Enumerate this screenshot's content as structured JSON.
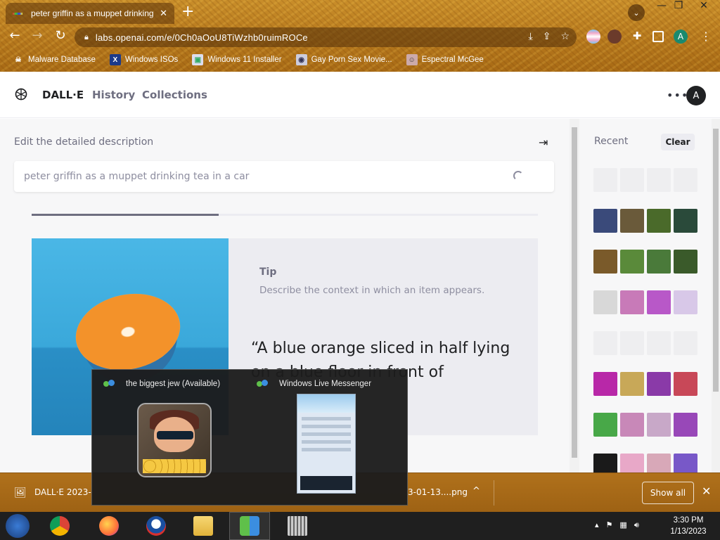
{
  "browser": {
    "tab_title": "peter griffin as a muppet drinking",
    "tab_close": "✕",
    "new_tab": "+",
    "url": "labs.openai.com/e/0Ch0aOoU8TiWzhb0ruimROCe",
    "profile_initial": "A",
    "bookmarks": [
      {
        "label": "Malware Database",
        "icon": "skull-icon"
      },
      {
        "label": "Windows ISOs",
        "icon": "x-icon"
      },
      {
        "label": "Windows 11 Installer",
        "icon": "windows-image-icon"
      },
      {
        "label": "Gay Porn Sex Movie...",
        "icon": "globe-icon"
      },
      {
        "label": "Espectral McGee",
        "icon": "face-icon"
      }
    ]
  },
  "app": {
    "brand": "DALL·E",
    "nav": [
      "History",
      "Collections"
    ],
    "more": "•••",
    "user_initial": "A"
  },
  "editor": {
    "label": "Edit the detailed description",
    "prompt_value": "peter griffin as a muppet drinking tea in  a car",
    "progress": 0.37
  },
  "tip": {
    "title": "Tip",
    "text": "Describe the context in which an item appears.",
    "quote": "“A blue orange sliced in half lying on a blue floor in front of"
  },
  "sidebar": {
    "recent_label": "Recent",
    "clear_label": "Clear",
    "rows": [
      [
        "#eeeef0",
        "#eeeef0",
        "#eeeef0",
        "#eeeef0"
      ],
      [
        "#3a4a7a",
        "#6a5a3a",
        "#4a6a2a",
        "#2a4a3a"
      ],
      [
        "#7a5a2a",
        "#5a8a3a",
        "#4a7a3a",
        "#3a5a2a"
      ],
      [
        "#d8d8d8",
        "#c87ab8",
        "#b858c8",
        "#d8c8e8"
      ],
      [
        "#eeeef0",
        "#eeeef0",
        "#eeeef0",
        "#eeeef0"
      ],
      [
        "#b828a8",
        "#c8a858",
        "#8a3aa8",
        "#c84858"
      ],
      [
        "#48a848",
        "#c888b8",
        "#c8a8c8",
        "#9848b8"
      ],
      [
        "#1a1a1a",
        "#e8a8c8",
        "#d8a8b8",
        "#7858c8"
      ]
    ]
  },
  "downloads": {
    "item1": "DALL·E 2023-",
    "item2": "3-01-13....png",
    "chevron": "^",
    "show_all": "Show all",
    "close": "✕"
  },
  "taskbar_preview": {
    "window1_title": "the biggest jew (Available)",
    "window2_title": "Windows Live Messenger"
  },
  "clock": {
    "time": "3:30 PM",
    "date": "1/13/2023"
  }
}
